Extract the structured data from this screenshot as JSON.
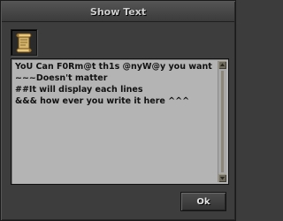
{
  "window": {
    "title": "Show Text"
  },
  "icon": {
    "name": "scroll-icon"
  },
  "text": {
    "content": "YoU Can F0Rm@t th1s @nyW@y you want\n~~~Doesn't matter\n##It will display each lines\n&&& how ever you write it here ^^^"
  },
  "buttons": {
    "ok_label": "Ok"
  },
  "colors": {
    "dialog_bg": "#3d3d3d",
    "textbox_bg": "#b4b4b4",
    "text": "#111111"
  }
}
